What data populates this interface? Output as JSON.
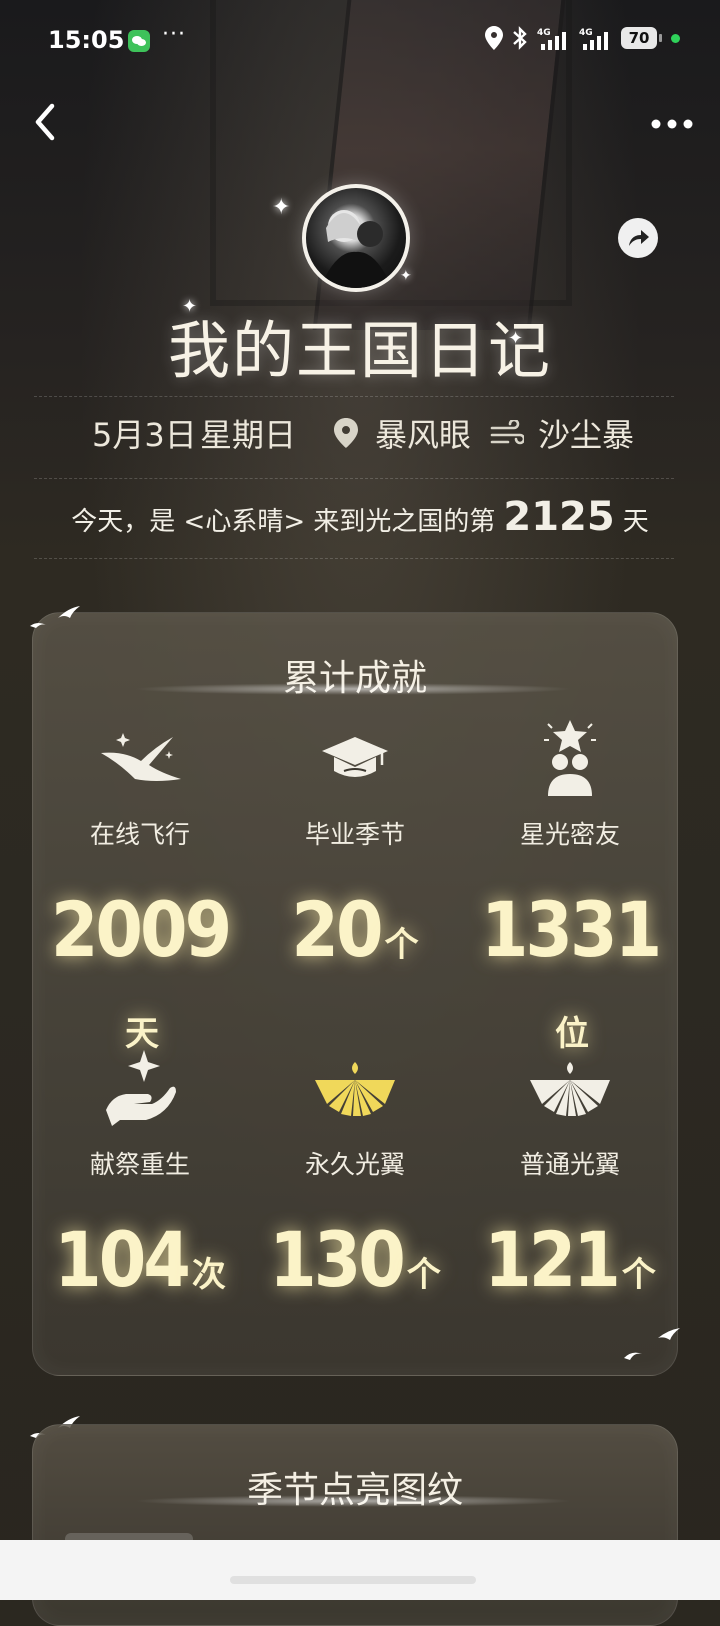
{
  "status_bar": {
    "time": "15:05",
    "battery": "70",
    "network_1": "4G",
    "network_2": "4G",
    "accent_green": "#2fd25a"
  },
  "header": {
    "back_icon": "chevron-left-icon",
    "menu_icon": "more-horizontal-icon",
    "share_icon": "share-arrow-icon"
  },
  "profile": {
    "avatar": "avatar",
    "title": "我的王国日记"
  },
  "info": {
    "date": "5月3日",
    "weekday": "星期日",
    "place": "暴风眼",
    "weather": "沙尘暴"
  },
  "days_line": {
    "prefix": "今天，是 <心系晴> 来到光之国的第",
    "days": "2125",
    "suffix": "天"
  },
  "achievements": {
    "title": "累计成就",
    "items": [
      {
        "icon": "bird-flight-icon",
        "label": "在线飞行",
        "value": "2009",
        "unit": "天"
      },
      {
        "icon": "graduation-cap-icon",
        "label": "毕业季节",
        "value": "20",
        "unit": "个"
      },
      {
        "icon": "star-friends-icon",
        "label": "星光密友",
        "value": "1331",
        "unit": "位"
      },
      {
        "icon": "hand-sparkle-icon",
        "label": "献祭重生",
        "value": "104",
        "unit": "次"
      },
      {
        "icon": "gold-wing-fan-icon",
        "label": "永久光翼",
        "value": "130",
        "unit": "个"
      },
      {
        "icon": "white-wing-fan-icon",
        "label": "普通光翼",
        "value": "121",
        "unit": "个"
      }
    ]
  },
  "patterns": {
    "title": "季节点亮图纹"
  },
  "colors": {
    "value_glow": "#fbf3c8",
    "gold_wing": "#f0d85a",
    "background": "#2b2820"
  }
}
